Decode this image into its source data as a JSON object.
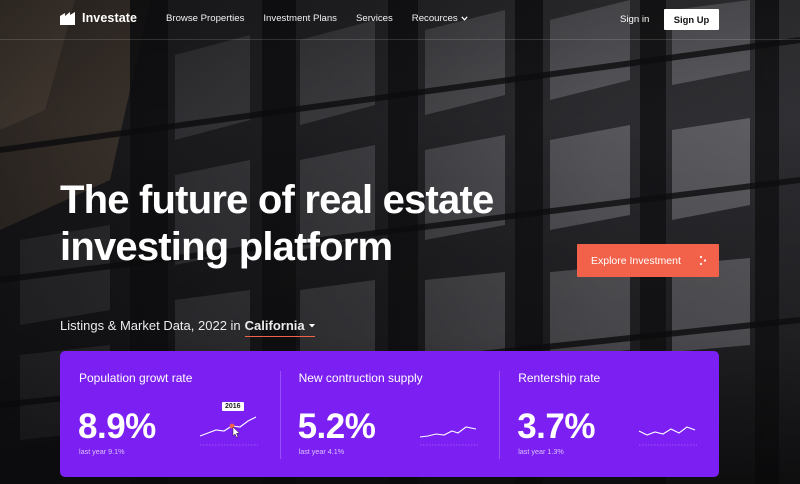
{
  "nav": {
    "brand": "Investate",
    "links": [
      {
        "label": "Browse Properties"
      },
      {
        "label": "Investment Plans"
      },
      {
        "label": "Services"
      },
      {
        "label": "Recources"
      }
    ],
    "sign_in": "Sign in",
    "sign_up": "Sign Up"
  },
  "hero": {
    "headline_line1": "The future of real estate",
    "headline_line2": "investing platform",
    "cta": "Explore Investment",
    "subtitle_prefix": "Listings & Market Data, 2022 in",
    "location": "California"
  },
  "stats": [
    {
      "label": "Population growt rate",
      "value": "8.9%",
      "sub": "last year 9.1%",
      "tag": "2016"
    },
    {
      "label": "New contruction supply",
      "value": "5.2%",
      "sub": "last year 4.1%"
    },
    {
      "label": "Rentership rate",
      "value": "3.7%",
      "sub": "last year 1.3%"
    }
  ],
  "colors": {
    "accent": "#f2624a",
    "panel": "#7b1ff2"
  },
  "icons": {
    "brand": "building-logo-icon",
    "dropdown": "chevron-down-icon",
    "cta": "dots-icon",
    "cursor": "pointer-cursor-icon"
  }
}
